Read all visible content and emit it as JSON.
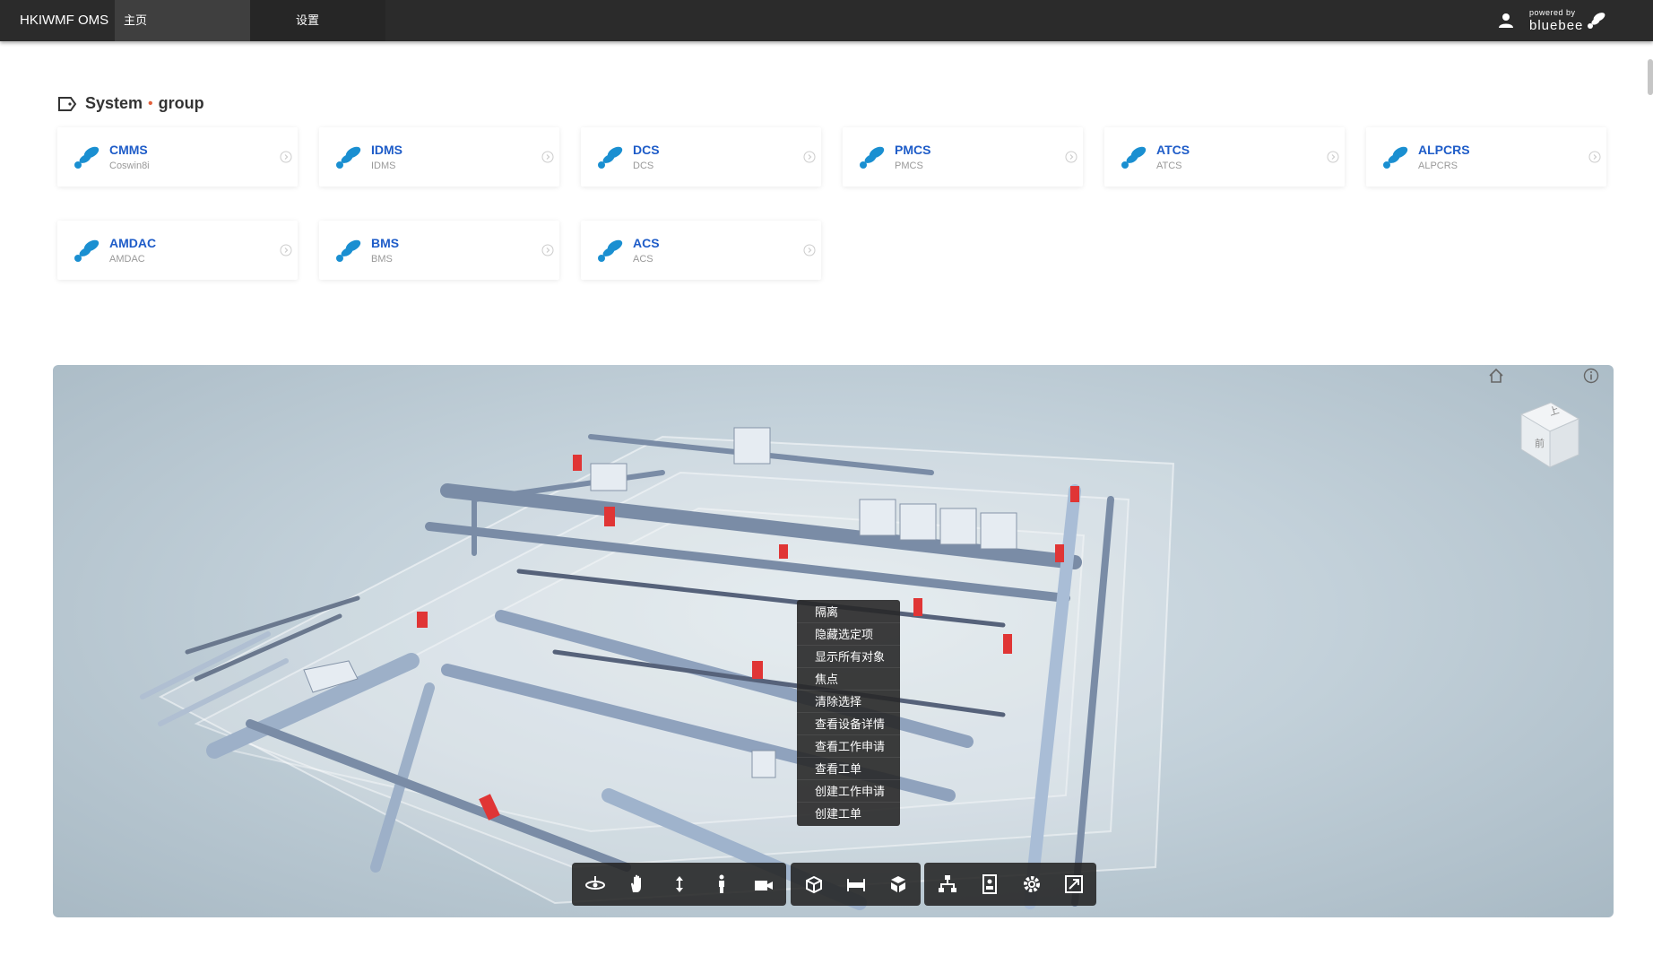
{
  "header": {
    "app_title": "HKIWMF OMS",
    "tabs": [
      {
        "label": "主页",
        "active": true
      },
      {
        "label": "设置",
        "active": false
      }
    ],
    "powered_by": "powered by",
    "brand": "bluebee"
  },
  "section": {
    "title": "System",
    "separator": "•",
    "subtitle": "group"
  },
  "systems": [
    {
      "name": "CMMS",
      "sub": "Coswin8i"
    },
    {
      "name": "IDMS",
      "sub": "IDMS"
    },
    {
      "name": "DCS",
      "sub": "DCS"
    },
    {
      "name": "PMCS",
      "sub": "PMCS"
    },
    {
      "name": "ATCS",
      "sub": "ATCS"
    },
    {
      "name": "ALPCRS",
      "sub": "ALPCRS"
    },
    {
      "name": "AMDAC",
      "sub": "AMDAC"
    },
    {
      "name": "BMS",
      "sub": "BMS"
    },
    {
      "name": "ACS",
      "sub": "ACS"
    }
  ],
  "viewer": {
    "view_cube": {
      "top": "上",
      "front": "前"
    },
    "context_menu": [
      "隔离",
      "隐藏选定项",
      "显示所有对象",
      "焦点",
      "清除选择",
      "查看设备详情",
      "查看工作申请",
      "查看工单",
      "创建工作申请",
      "创建工单"
    ],
    "toolbar_icons": [
      [
        "orbit-icon",
        "pan-icon",
        "zoom-icon",
        "first-person-icon",
        "camera-icon"
      ],
      [
        "section-box-icon",
        "measure-icon",
        "explode-icon"
      ],
      [
        "model-browser-icon",
        "properties-icon",
        "settings-icon",
        "fullscreen-icon"
      ]
    ]
  },
  "colors": {
    "topbar": "#2b2b2b",
    "link": "#1e5cc8",
    "logo": "#1a8fd1",
    "accent": "#e2603b",
    "equipment_red": "#e03535"
  }
}
